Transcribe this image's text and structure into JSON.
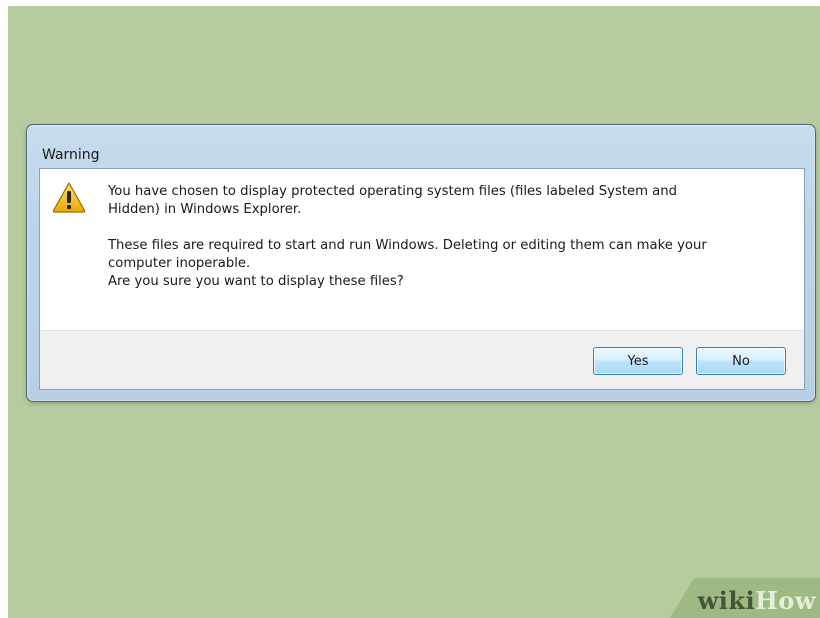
{
  "dialog": {
    "title": "Warning",
    "message": {
      "line1": "You have chosen to display protected operating system files (files labeled System and",
      "line2": "Hidden) in Windows Explorer.",
      "line3": "These files are required to start and run Windows. Deleting or editing them can make your",
      "line4": "computer inoperable.",
      "line5": "Are you sure you want to display these files?"
    },
    "buttons": {
      "yes": "Yes",
      "no": "No"
    },
    "icon": "warning-icon"
  },
  "watermark": {
    "part1": "wiki",
    "part2": "How"
  },
  "colors": {
    "background": "#b6cc9f",
    "frame": "#bcd3e8",
    "warning_yellow": "#f5c400"
  }
}
